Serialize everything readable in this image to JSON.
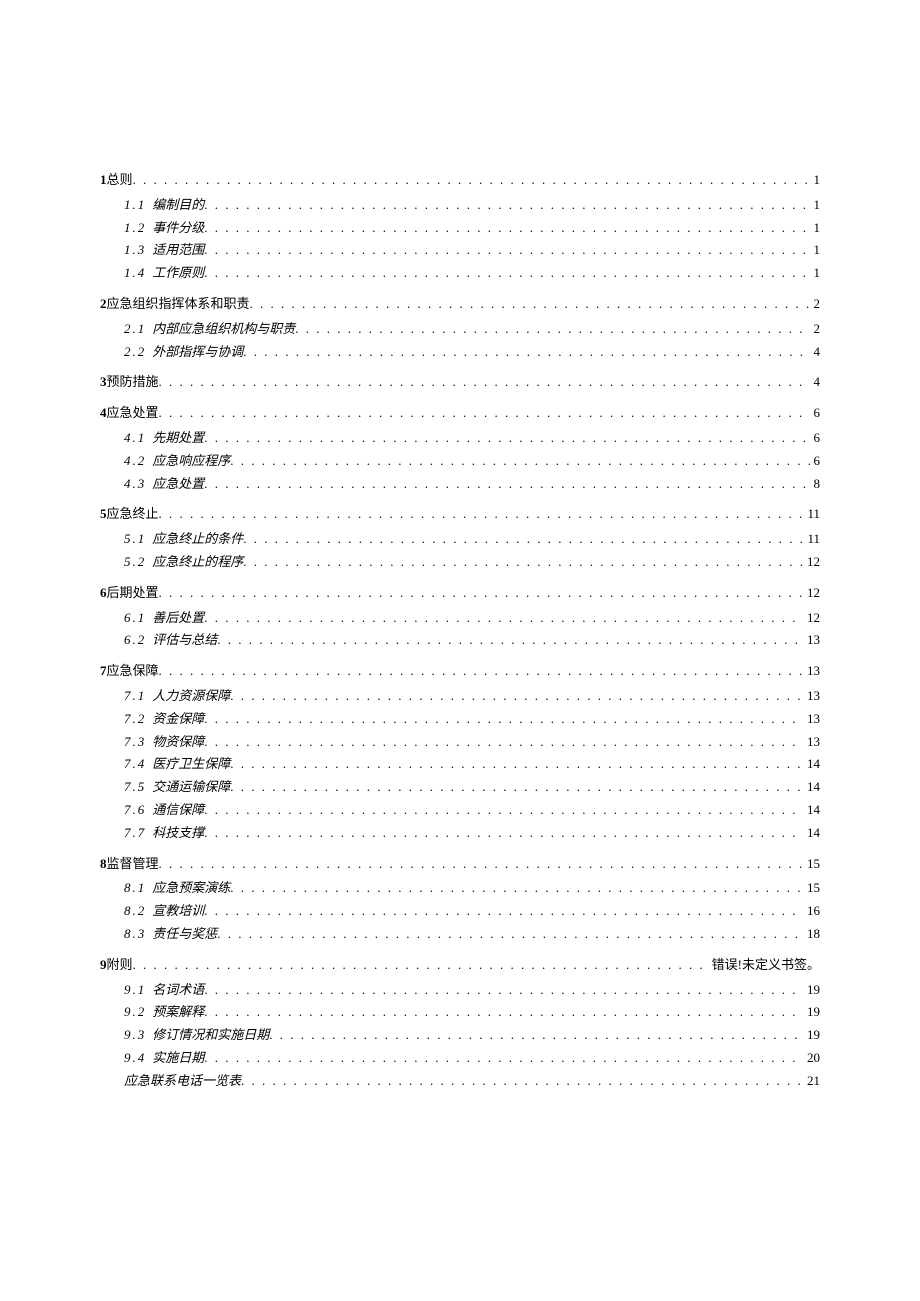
{
  "toc": [
    {
      "level": 1,
      "num": "1",
      "title": "总则",
      "page": "1"
    },
    {
      "level": 2,
      "num": "1.1",
      "title": "编制目的",
      "page": "1"
    },
    {
      "level": 2,
      "num": "1.2",
      "title": "事件分级",
      "page": "1"
    },
    {
      "level": 2,
      "num": "1.3",
      "title": "适用范围",
      "page": "1"
    },
    {
      "level": 2,
      "num": "1.4",
      "title": "工作原则",
      "page": "1"
    },
    {
      "level": 1,
      "num": "2",
      "title": "应急组织指挥体系和职责",
      "page": "2"
    },
    {
      "level": 2,
      "num": "2.1",
      "title": "内部应急组织机构与职责",
      "page": "2"
    },
    {
      "level": 2,
      "num": "2.2",
      "title": "外部指挥与协调",
      "page": "4"
    },
    {
      "level": 1,
      "num": "3",
      "title": "预防措施",
      "page": "4"
    },
    {
      "level": 1,
      "num": "4",
      "title": "应急处置",
      "page": "6"
    },
    {
      "level": 2,
      "num": "4.1",
      "title": "先期处置",
      "page": "6"
    },
    {
      "level": 2,
      "num": "4.2",
      "title": "应急响应程序",
      "page": "6"
    },
    {
      "level": 2,
      "num": "4.3",
      "title": "应急处置",
      "page": "8"
    },
    {
      "level": 1,
      "num": "5",
      "title": "应急终止",
      "page": "11"
    },
    {
      "level": 2,
      "num": "5.1",
      "title": "应急终止的条件",
      "page": "11"
    },
    {
      "level": 2,
      "num": "5.2",
      "title": "应急终止的程序",
      "page": "12"
    },
    {
      "level": 1,
      "num": "6",
      "title": "后期处置",
      "page": "12"
    },
    {
      "level": 2,
      "num": "6.1",
      "title": "善后处置",
      "page": "12"
    },
    {
      "level": 2,
      "num": "6.2",
      "title": "评估与总结",
      "page": "13"
    },
    {
      "level": 1,
      "num": "7",
      "title": "应急保障",
      "page": "13"
    },
    {
      "level": 2,
      "num": "7.1",
      "title": "人力资源保障",
      "page": "13"
    },
    {
      "level": 2,
      "num": "7.2",
      "title": "资金保障",
      "page": "13"
    },
    {
      "level": 2,
      "num": "7.3",
      "title": "物资保障",
      "page": "13"
    },
    {
      "level": 2,
      "num": "7.4",
      "title": "医疗卫生保障",
      "page": "14"
    },
    {
      "level": 2,
      "num": "7.5",
      "title": "交通运输保障",
      "page": "14"
    },
    {
      "level": 2,
      "num": "7.6",
      "title": "通信保障",
      "page": "14"
    },
    {
      "level": 2,
      "num": "7.7",
      "title": "科技支撑",
      "page": "14"
    },
    {
      "level": 1,
      "num": "8",
      "title": "监督管理",
      "page": "15"
    },
    {
      "level": 2,
      "num": "8.1",
      "title": "应急预案演练",
      "page": "15"
    },
    {
      "level": 2,
      "num": "8.2",
      "title": "宣教培训",
      "page": "16"
    },
    {
      "level": 2,
      "num": "8.3",
      "title": "责任与奖惩",
      "page": "18"
    },
    {
      "level": 1,
      "num": "9",
      "title": "附则",
      "page": "错误!未定义书签。"
    },
    {
      "level": 2,
      "num": "9.1",
      "title": "名词术语",
      "page": "19"
    },
    {
      "level": 2,
      "num": "9.2",
      "title": "预案解释",
      "page": "19"
    },
    {
      "level": 2,
      "num": "9.3",
      "title": "修订情况和实施日期",
      "page": "19"
    },
    {
      "level": 2,
      "num": "9.4",
      "title": "实施日期",
      "page": "20"
    },
    {
      "level": 2,
      "num": "",
      "title": "应急联系电话一览表",
      "page": "21"
    }
  ]
}
